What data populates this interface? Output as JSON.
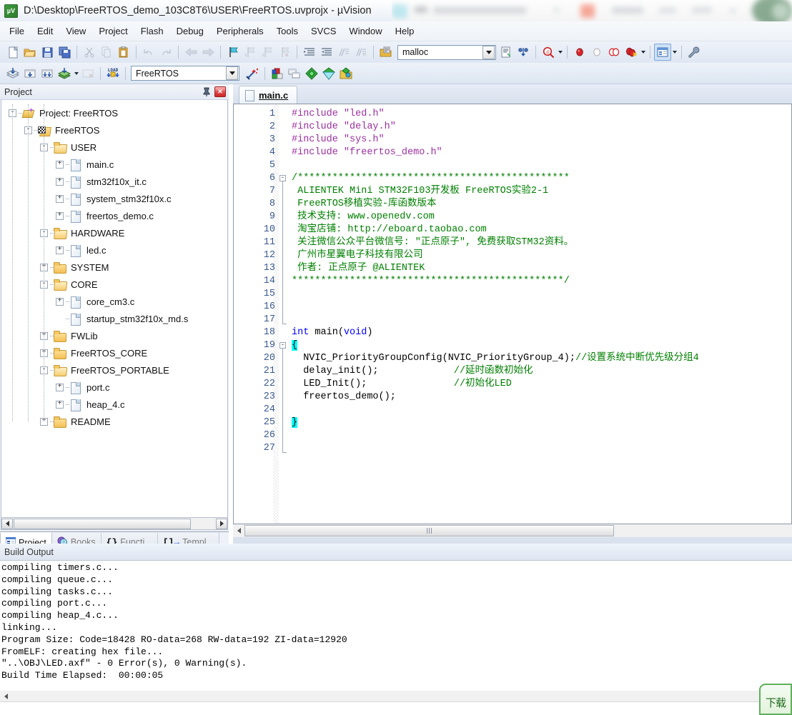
{
  "window": {
    "title": "D:\\Desktop\\FreeRTOS_demo_103C8T6\\USER\\FreeRTOS.uvprojx - µVision",
    "logo_icon": "uvision-logo-icon"
  },
  "menu": {
    "items": [
      "File",
      "Edit",
      "View",
      "Project",
      "Flash",
      "Debug",
      "Peripherals",
      "Tools",
      "SVCS",
      "Window",
      "Help"
    ]
  },
  "toolbar_main": {
    "buttons": [
      {
        "name": "new-file-button",
        "icon": "new-file-icon"
      },
      {
        "name": "open-file-button",
        "icon": "open-folder-icon"
      },
      {
        "name": "save-button",
        "icon": "save-disk-icon"
      },
      {
        "name": "save-all-button",
        "icon": "save-all-icon"
      },
      {
        "name": "cut-button",
        "icon": "scissors-icon"
      },
      {
        "name": "copy-button",
        "icon": "copy-icon"
      },
      {
        "name": "paste-button",
        "icon": "clipboard-paste-icon"
      },
      {
        "name": "undo-button",
        "icon": "undo-arrow-icon"
      },
      {
        "name": "redo-button",
        "icon": "redo-arrow-icon"
      },
      {
        "name": "navigate-back-button",
        "icon": "arrow-left-icon"
      },
      {
        "name": "navigate-forward-button",
        "icon": "arrow-right-icon"
      },
      {
        "name": "insert-bookmark-button",
        "icon": "bookmark-flag-icon"
      },
      {
        "name": "prev-bookmark-button",
        "icon": "bookmark-prev-icon"
      },
      {
        "name": "next-bookmark-button",
        "icon": "bookmark-next-icon"
      },
      {
        "name": "clear-bookmarks-button",
        "icon": "bookmark-clear-icon"
      },
      {
        "name": "indent-button",
        "icon": "indent-right-icon"
      },
      {
        "name": "outdent-button",
        "icon": "indent-left-icon"
      },
      {
        "name": "comment-button",
        "icon": "comment-lines-icon"
      },
      {
        "name": "uncomment-button",
        "icon": "uncomment-lines-icon"
      },
      {
        "name": "open-included-file-button",
        "icon": "open-include-icon"
      }
    ],
    "search_value": "malloc",
    "search_placeholder": "",
    "after_buttons": [
      {
        "name": "bookmark-list-button",
        "icon": "document-list-icon"
      },
      {
        "name": "find-in-files-button",
        "icon": "binoculars-icon"
      },
      {
        "name": "incremental-find-button",
        "icon": "find-magnifier-icon"
      },
      {
        "name": "insert-breakpoint-button",
        "icon": "breakpoint-red-dot-icon"
      },
      {
        "name": "disable-breakpoint-button",
        "icon": "breakpoint-hollow-icon"
      },
      {
        "name": "disable-all-breakpoints-button",
        "icon": "breakpoint-disabled-icon"
      },
      {
        "name": "kill-all-breakpoints-button",
        "icon": "breakpoint-kill-icon"
      },
      {
        "name": "manage-windows-button",
        "icon": "window-layout-icon"
      },
      {
        "name": "configure-button",
        "icon": "wrench-icon"
      }
    ]
  },
  "toolbar_build": {
    "buttons": [
      {
        "name": "translate-button",
        "icon": "translate-file-icon"
      },
      {
        "name": "build-button",
        "icon": "build-target-icon"
      },
      {
        "name": "rebuild-button",
        "icon": "rebuild-all-icon"
      },
      {
        "name": "batch-build-button",
        "icon": "batch-build-icon"
      },
      {
        "name": "stop-build-button",
        "icon": "stop-build-icon"
      },
      {
        "name": "download-button",
        "icon": "load-download-icon"
      }
    ],
    "target_value": "FreeRTOS",
    "after_buttons": [
      {
        "name": "target-options-button",
        "icon": "magic-wand-icon"
      },
      {
        "name": "manage-project-items-button",
        "icon": "project-items-icon"
      },
      {
        "name": "manage-multi-project-button",
        "icon": "multi-project-icon"
      },
      {
        "name": "pack-installer-button",
        "icon": "green-diamond-icon"
      },
      {
        "name": "manage-run-time-env-button",
        "icon": "rte-diamond-icon"
      },
      {
        "name": "select-software-packs-button",
        "icon": "software-packs-icon"
      }
    ]
  },
  "project_panel": {
    "title": "Project",
    "pin_icon": "pin-icon",
    "close_icon": "close-icon",
    "tree": [
      {
        "label": "Project: FreeRTOS",
        "depth": 0,
        "icon": "project-icon",
        "expander": "-"
      },
      {
        "label": "FreeRTOS",
        "depth": 1,
        "icon": "target-icon",
        "expander": "-"
      },
      {
        "label": "USER",
        "depth": 2,
        "icon": "folder-open-icon",
        "expander": "-"
      },
      {
        "label": "main.c",
        "depth": 3,
        "icon": "file-icon",
        "expander": "+"
      },
      {
        "label": "stm32f10x_it.c",
        "depth": 3,
        "icon": "file-icon",
        "expander": "+"
      },
      {
        "label": "system_stm32f10x.c",
        "depth": 3,
        "icon": "file-icon",
        "expander": "+"
      },
      {
        "label": "freertos_demo.c",
        "depth": 3,
        "icon": "file-icon",
        "expander": "+"
      },
      {
        "label": "HARDWARE",
        "depth": 2,
        "icon": "folder-open-icon",
        "expander": "-"
      },
      {
        "label": "led.c",
        "depth": 3,
        "icon": "file-icon",
        "expander": "+"
      },
      {
        "label": "SYSTEM",
        "depth": 2,
        "icon": "folder-icon",
        "expander": "+"
      },
      {
        "label": "CORE",
        "depth": 2,
        "icon": "folder-open-icon",
        "expander": "-"
      },
      {
        "label": "core_cm3.c",
        "depth": 3,
        "icon": "file-icon",
        "expander": "+"
      },
      {
        "label": "startup_stm32f10x_md.s",
        "depth": 3,
        "icon": "file-icon",
        "expander": ""
      },
      {
        "label": "FWLib",
        "depth": 2,
        "icon": "folder-icon",
        "expander": "+"
      },
      {
        "label": "FreeRTOS_CORE",
        "depth": 2,
        "icon": "folder-icon",
        "expander": "+"
      },
      {
        "label": "FreeRTOS_PORTABLE",
        "depth": 2,
        "icon": "folder-open-icon",
        "expander": "-"
      },
      {
        "label": "port.c",
        "depth": 3,
        "icon": "file-icon",
        "expander": "+"
      },
      {
        "label": "heap_4.c",
        "depth": 3,
        "icon": "file-icon",
        "expander": "+"
      },
      {
        "label": "README",
        "depth": 2,
        "icon": "folder-icon",
        "expander": "+"
      }
    ],
    "tabs": [
      {
        "label": "Project",
        "icon": "project-tab-icon",
        "active": true
      },
      {
        "label": "Books",
        "icon": "books-icon",
        "active": false
      },
      {
        "label": "Functi...",
        "icon": "braces-icon",
        "active": false
      },
      {
        "label": "Templ...",
        "icon": "template-icon",
        "active": false
      }
    ]
  },
  "editor": {
    "tab": {
      "label": "main.c",
      "icon": "source-file-icon"
    },
    "lines": [
      {
        "n": 1,
        "tokens": [
          {
            "t": "#include ",
            "c": "pre"
          },
          {
            "t": "\"led.h\"",
            "c": "str"
          }
        ]
      },
      {
        "n": 2,
        "tokens": [
          {
            "t": "#include ",
            "c": "pre"
          },
          {
            "t": "\"delay.h\"",
            "c": "str"
          }
        ]
      },
      {
        "n": 3,
        "tokens": [
          {
            "t": "#include ",
            "c": "pre"
          },
          {
            "t": "\"sys.h\"",
            "c": "str"
          }
        ]
      },
      {
        "n": 4,
        "tokens": [
          {
            "t": "#include ",
            "c": "pre"
          },
          {
            "t": "\"freertos_demo.h\"",
            "c": "str"
          }
        ]
      },
      {
        "n": 5,
        "tokens": []
      },
      {
        "n": 6,
        "tokens": [
          {
            "t": "/***********************************************",
            "c": "cmt"
          }
        ]
      },
      {
        "n": 7,
        "tokens": [
          {
            "t": " ALIENTEK Mini STM32F103开发板 FreeRTOS实验2-1",
            "c": "cmt"
          }
        ]
      },
      {
        "n": 8,
        "tokens": [
          {
            "t": " FreeRTOS移植实验-库函数版本",
            "c": "cmt"
          }
        ]
      },
      {
        "n": 9,
        "tokens": [
          {
            "t": " 技术支持: www.openedv.com",
            "c": "cmt"
          }
        ]
      },
      {
        "n": 10,
        "tokens": [
          {
            "t": " 淘宝店铺: http://eboard.taobao.com",
            "c": "cmt"
          }
        ]
      },
      {
        "n": 11,
        "tokens": [
          {
            "t": " 关注微信公众平台微信号: \"正点原子\", 免费获取STM32资料。",
            "c": "cmt"
          }
        ]
      },
      {
        "n": 12,
        "tokens": [
          {
            "t": " 广州市星翼电子科技有限公司",
            "c": "cmt"
          }
        ]
      },
      {
        "n": 13,
        "tokens": [
          {
            "t": " 作者: 正点原子 @ALIENTEK",
            "c": "cmt"
          }
        ]
      },
      {
        "n": 14,
        "tokens": [
          {
            "t": "***********************************************/",
            "c": "cmt"
          }
        ]
      },
      {
        "n": 15,
        "tokens": []
      },
      {
        "n": 16,
        "tokens": []
      },
      {
        "n": 17,
        "tokens": []
      },
      {
        "n": 18,
        "tokens": [
          {
            "t": "int",
            "c": "kw"
          },
          {
            "t": " main(",
            "c": "pln"
          },
          {
            "t": "void",
            "c": "kw"
          },
          {
            "t": ")",
            "c": "pln"
          }
        ]
      },
      {
        "n": 19,
        "tokens": [
          {
            "t": "{",
            "c": "brc"
          }
        ]
      },
      {
        "n": 20,
        "tokens": [
          {
            "t": "  NVIC_PriorityGroupConfig(NVIC_PriorityGroup_4);",
            "c": "pln"
          },
          {
            "t": "//设置系统中断优先级分组4",
            "c": "cmt"
          }
        ]
      },
      {
        "n": 21,
        "tokens": [
          {
            "t": "  delay_init();             ",
            "c": "pln"
          },
          {
            "t": "//延时函数初始化",
            "c": "cmt"
          }
        ]
      },
      {
        "n": 22,
        "tokens": [
          {
            "t": "  LED_Init();               ",
            "c": "pln"
          },
          {
            "t": "//初始化LED",
            "c": "cmt"
          }
        ]
      },
      {
        "n": 23,
        "tokens": [
          {
            "t": "  freertos_demo();",
            "c": "pln"
          }
        ]
      },
      {
        "n": 24,
        "tokens": []
      },
      {
        "n": 25,
        "tokens": [
          {
            "t": "}",
            "c": "brc"
          }
        ]
      },
      {
        "n": 26,
        "tokens": []
      },
      {
        "n": 27,
        "tokens": []
      }
    ],
    "folds": [
      {
        "line": 6,
        "end": 17
      },
      {
        "line": 19,
        "end": 27
      }
    ]
  },
  "build_output": {
    "title": "Build Output",
    "lines": [
      "compiling timers.c...",
      "compiling queue.c...",
      "compiling tasks.c...",
      "compiling port.c...",
      "compiling heap_4.c...",
      "linking...",
      "Program Size: Code=18428 RO-data=268 RW-data=192 ZI-data=12920",
      "FromELF: creating hex file...",
      "\"..\\OBJ\\LED.axf\" - 0 Error(s), 0 Warning(s).",
      "Build Time Elapsed:  00:00:05"
    ]
  },
  "overlay": {
    "green_widget_text": "下载"
  },
  "colors": {
    "keyword": "#0000ff",
    "preprocessor": "#9b30a0",
    "string": "#9b30a0",
    "comment": "#008000",
    "brace_highlight": "#00ffff",
    "line_number": "#3a5a8c",
    "accent": "#2d7a2d"
  }
}
